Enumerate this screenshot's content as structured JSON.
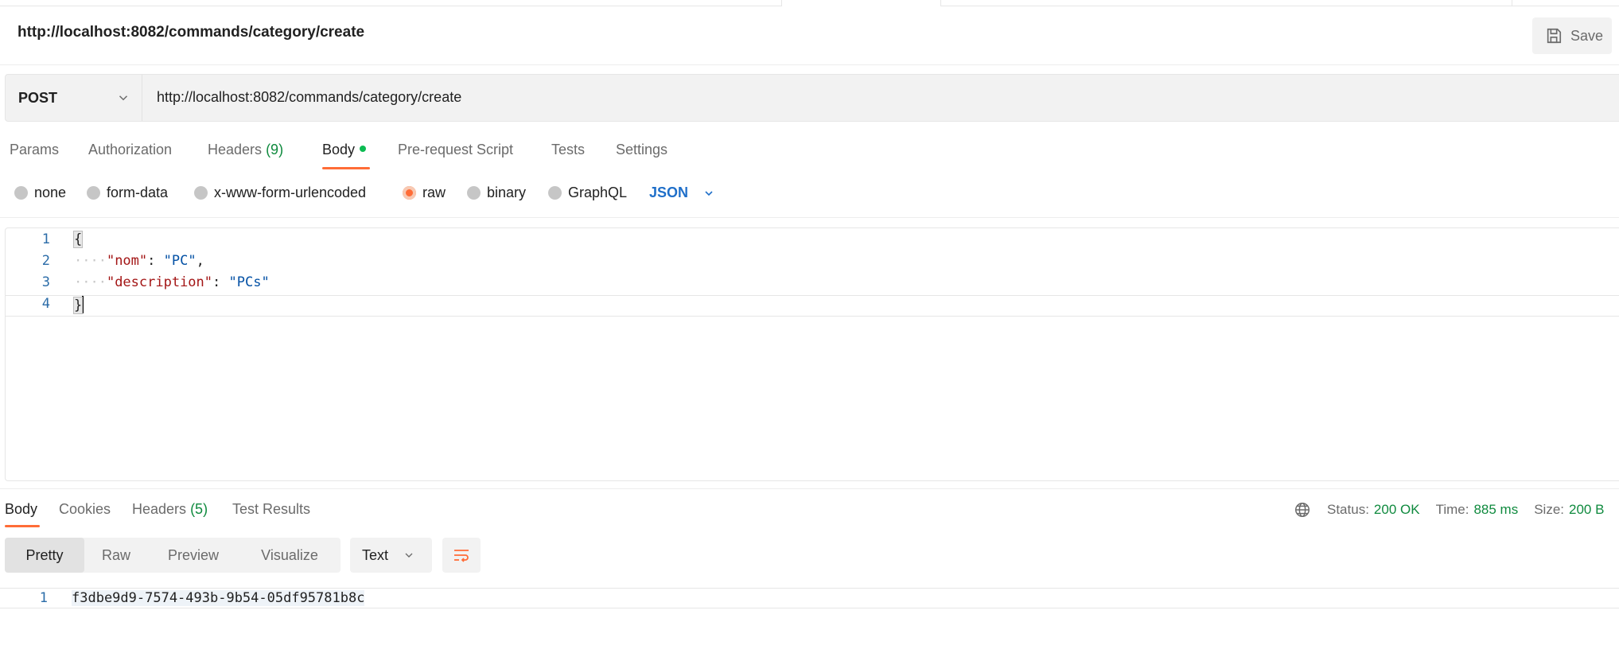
{
  "request": {
    "title": "http://localhost:8082/commands/category/create",
    "save_label": "Save",
    "method": "POST",
    "url": "http://localhost:8082/commands/category/create"
  },
  "request_tabs": {
    "params": "Params",
    "authorization": "Authorization",
    "headers": "Headers",
    "headers_count": "(9)",
    "body": "Body",
    "prerequest": "Pre-request Script",
    "tests": "Tests",
    "settings": "Settings"
  },
  "body_types": {
    "none": "none",
    "form_data": "form-data",
    "urlencoded": "x-www-form-urlencoded",
    "raw": "raw",
    "binary": "binary",
    "graphql": "GraphQL",
    "language": "JSON",
    "selected": "raw"
  },
  "editor": {
    "line_numbers": [
      "1",
      "2",
      "3",
      "4"
    ],
    "open_brace": "{",
    "close_brace": "}",
    "indent": "····",
    "key_nom": "\"nom\"",
    "value_nom": "\"PC\"",
    "key_description": "\"description\"",
    "value_description": "\"PCs\"",
    "colon": ":",
    "comma": ","
  },
  "response_tabs": {
    "body": "Body",
    "cookies": "Cookies",
    "headers": "Headers",
    "headers_count": "(5)",
    "test_results": "Test Results"
  },
  "response_status": {
    "status_label": "Status:",
    "status_value": "200 OK",
    "time_label": "Time:",
    "time_value": "885 ms",
    "size_label": "Size:",
    "size_value": "200 B"
  },
  "response_view": {
    "pretty": "Pretty",
    "raw": "Raw",
    "preview": "Preview",
    "visualize": "Visualize",
    "format": "Text",
    "active": "Pretty"
  },
  "response_body": {
    "line_number": "1",
    "content": "f3dbe9d9-7574-493b-9b54-05df95781b8c"
  },
  "colors": {
    "accent": "#ff6c37",
    "success": "#0f8a3e",
    "link": "#1f6fc9"
  },
  "icons": [
    "save-icon",
    "chevron-down-icon",
    "globe-icon",
    "wrap-lines-icon"
  ]
}
